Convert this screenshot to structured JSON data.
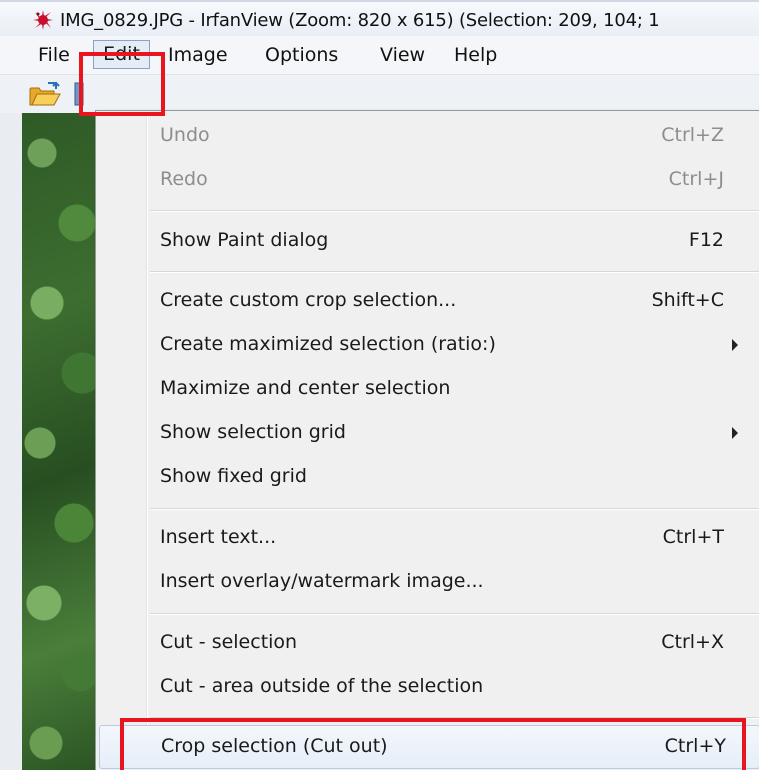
{
  "window": {
    "title": "IMG_0829.JPG - IrfanView (Zoom: 820 x 615) (Selection: 209, 104; 1"
  },
  "menubar": {
    "items": [
      "File",
      "Edit",
      "Image",
      "Options",
      "View",
      "Help"
    ]
  },
  "edit_menu": {
    "items": [
      {
        "label": "Undo",
        "shortcut": "Ctrl+Z",
        "disabled": true
      },
      {
        "label": "Redo",
        "shortcut": "Ctrl+J",
        "disabled": true
      },
      {
        "label": "Show Paint dialog",
        "shortcut": "F12"
      },
      {
        "label": "Create custom crop selection...",
        "shortcut": "Shift+C"
      },
      {
        "label": "Create maximized selection (ratio:)",
        "submenu": true
      },
      {
        "label": "Maximize and center selection"
      },
      {
        "label": "Show selection grid",
        "submenu": true
      },
      {
        "label": "Show fixed grid"
      },
      {
        "label": "Insert text...",
        "shortcut": "Ctrl+T"
      },
      {
        "label": "Insert overlay/watermark image..."
      },
      {
        "label": "Cut - selection",
        "shortcut": "Ctrl+X"
      },
      {
        "label": "Cut - area outside of the selection"
      },
      {
        "label": "Crop selection (Cut out)",
        "shortcut": "Ctrl+Y",
        "highlighted": true
      }
    ]
  },
  "colors": {
    "annotation": "#e8141e",
    "app_icon": "#c8102e"
  },
  "icons": {
    "app": "irfanview-red-cat-icon",
    "open": "open-folder-icon",
    "toolbar_partial": "toolbar-icon"
  }
}
